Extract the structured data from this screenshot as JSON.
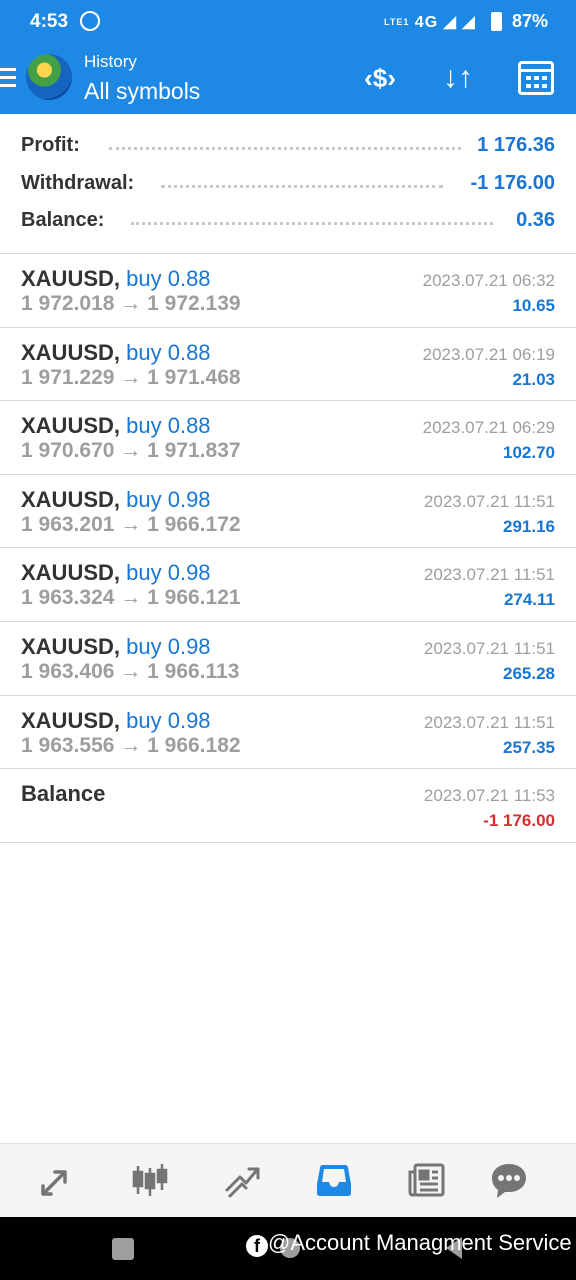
{
  "status_bar": {
    "time": "4:53",
    "network": "4G",
    "network_tag": "LTE1",
    "battery": "87%"
  },
  "toolbar": {
    "subtitle": "History",
    "title": "All symbols",
    "icons": [
      "menu-icon",
      "app-logo-icon",
      "deposit-icon",
      "sort-icon",
      "calendar-icon"
    ],
    "accent_color": "#1e88e5"
  },
  "summary": {
    "profit_label": "Profit:",
    "profit_value": "1 176.36",
    "withdrawal_label": "Withdrawal:",
    "withdrawal_value": "-1 176.00",
    "balance_label": "Balance:",
    "balance_value": "0.36"
  },
  "deals": [
    {
      "symbol": "XAUUSD,",
      "direction": "buy 0.88",
      "open": "1 972.018",
      "close": "1 972.139",
      "arrow": "→",
      "date": "2023.07.21 06:32",
      "profit": "10.65"
    },
    {
      "symbol": "XAUUSD,",
      "direction": "buy 0.88",
      "open": "1 971.229",
      "close": "1 971.468",
      "arrow": "→",
      "date": "2023.07.21 06:19",
      "profit": "21.03"
    },
    {
      "symbol": "XAUUSD,",
      "direction": "buy 0.88",
      "open": "1 970.670",
      "close": "1 971.837",
      "arrow": "→",
      "date": "2023.07.21 06:29",
      "profit": "102.70"
    },
    {
      "symbol": "XAUUSD,",
      "direction": "buy 0.98",
      "open": "1 963.201",
      "close": "1 966.172",
      "arrow": "→",
      "date": "2023.07.21 11:51",
      "profit": "291.16"
    },
    {
      "symbol": "XAUUSD,",
      "direction": "buy 0.98",
      "open": "1 963.324",
      "close": "1 966.121",
      "arrow": "→",
      "date": "2023.07.21 11:51",
      "profit": "274.11"
    },
    {
      "symbol": "XAUUSD,",
      "direction": "buy 0.98",
      "open": "1 963.406",
      "close": "1 966.113",
      "arrow": "→",
      "date": "2023.07.21 11:51",
      "profit": "265.28"
    },
    {
      "symbol": "XAUUSD,",
      "direction": "buy 0.98",
      "open": "1 963.556",
      "close": "1 966.182",
      "arrow": "→",
      "date": "2023.07.21 11:51",
      "profit": "257.35"
    }
  ],
  "balance_entry": {
    "label": "Balance",
    "date": "2023.07.21 11:53",
    "amount": "-1 176.00",
    "amount_color": "#d32f2f"
  },
  "bottom_nav": {
    "items": [
      "quotes-icon",
      "chart-icon",
      "trade-icon",
      "history-icon",
      "news-icon",
      "chat-icon"
    ],
    "active": "history-icon"
  },
  "watermark": {
    "fb_glyph": "f",
    "text": "@Account Managment Service"
  }
}
